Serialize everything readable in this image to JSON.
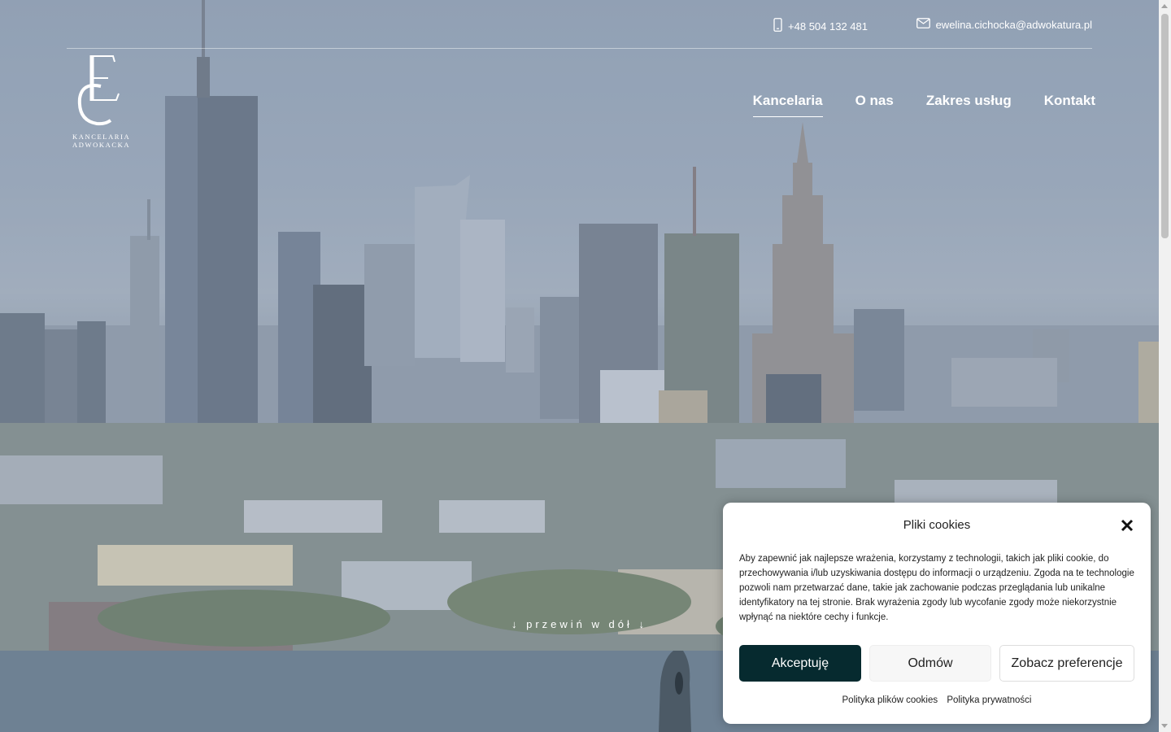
{
  "topbar": {
    "phone": "+48 504 132 481",
    "email": "ewelina.cichocka@adwokatura.pl",
    "phone_icon": "phone-icon",
    "email_icon": "envelope-icon"
  },
  "logo": {
    "monogram": "EC",
    "line1": "KANCELARIA",
    "line2": "ADWOKACKA"
  },
  "nav": {
    "items": [
      {
        "label": "Kancelaria",
        "active": true
      },
      {
        "label": "O nas",
        "active": false
      },
      {
        "label": "Zakres usług",
        "active": false
      },
      {
        "label": "Kontakt",
        "active": false
      }
    ]
  },
  "hero": {
    "scroll_hint": "↓ przewiń w dół ↓"
  },
  "cookie": {
    "title": "Pliki cookies",
    "text": "Aby zapewnić jak najlepsze wrażenia, korzystamy z technologii, takich jak pliki cookie, do przechowywania i/lub uzyskiwania dostępu do informacji o urządzeniu. Zgoda na te technologie pozwoli nam przetwarzać dane, takie jak zachowanie podczas przeglądania lub unikalne identyfikatory na tej stronie. Brak wyrażenia zgody lub wycofanie zgody może niekorzystnie wpłynąć na niektóre cechy i funkcje.",
    "accept_label": "Akceptuję",
    "deny_label": "Odmów",
    "prefs_label": "Zobacz preferencje",
    "link_cookies": "Polityka plików cookies",
    "link_privacy": "Polityka prywatności",
    "accent_color": "#062a2f"
  }
}
